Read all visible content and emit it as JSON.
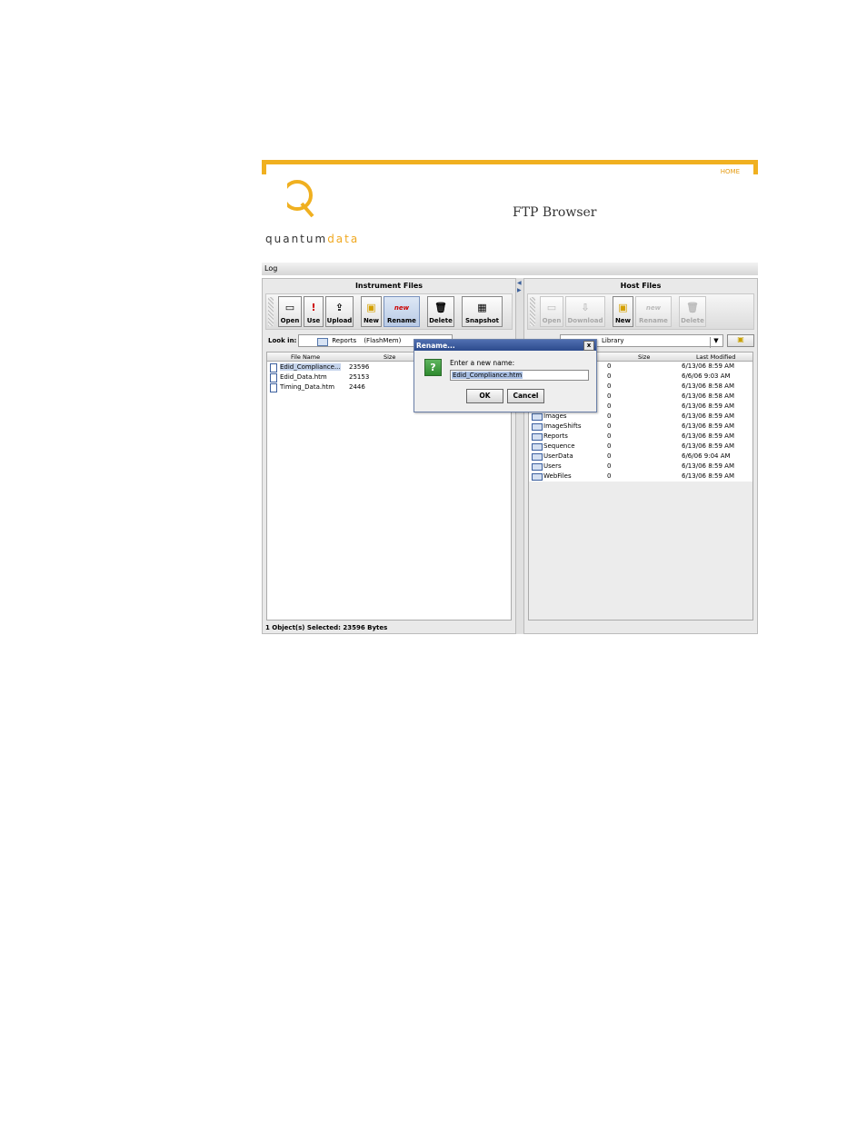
{
  "header": {
    "home": "HOME",
    "logo_main": "quantum",
    "logo_accent": "data",
    "title": "FTP Browser"
  },
  "log": {
    "label": "Log"
  },
  "instrument": {
    "title": "Instrument Files",
    "toolbar": {
      "open": "Open",
      "use": "Use",
      "upload": "Upload",
      "new": "New",
      "rename": "Rename",
      "delete": "Delete",
      "snapshot": "Snapshot"
    },
    "look_in_label": "Look in:",
    "look_in_value": "Reports",
    "look_in_extra": "(FlashMem)",
    "columns": {
      "name": "File Name",
      "size": "Size"
    },
    "files": [
      {
        "name": "Edid_Compliance...",
        "size": "23596"
      },
      {
        "name": "Edid_Data.htm",
        "size": "25153"
      },
      {
        "name": "Timing_Data.htm",
        "size": "2446"
      }
    ],
    "status": "1 Object(s) Selected:  23596 Bytes"
  },
  "host": {
    "title": "Host Files",
    "toolbar": {
      "open": "Open",
      "download": "Download",
      "new": "New",
      "rename": "Rename",
      "delete": "Delete"
    },
    "look_in_value": "Library",
    "columns": {
      "size": "Size",
      "modified": "Last Modified"
    },
    "rows": [
      {
        "name": "",
        "size": "0",
        "modified": "6/13/06 8:59 AM"
      },
      {
        "name": "",
        "size": "0",
        "modified": "6/6/06 9:03 AM"
      },
      {
        "name": "",
        "size": "0",
        "modified": "6/13/06 8:58 AM"
      },
      {
        "name": "",
        "size": "0",
        "modified": "6/13/06 8:58 AM"
      },
      {
        "name": "",
        "size": "0",
        "modified": "6/13/06 8:59 AM"
      },
      {
        "name": "Images",
        "size": "0",
        "modified": "6/13/06 8:59 AM"
      },
      {
        "name": "ImageShifts",
        "size": "0",
        "modified": "6/13/06 8:59 AM"
      },
      {
        "name": "Reports",
        "size": "0",
        "modified": "6/13/06 8:59 AM"
      },
      {
        "name": "Sequence",
        "size": "0",
        "modified": "6/13/06 8:59 AM"
      },
      {
        "name": "UserData",
        "size": "0",
        "modified": "6/6/06 9:04 AM"
      },
      {
        "name": "Users",
        "size": "0",
        "modified": "6/13/06 8:59 AM"
      },
      {
        "name": "WebFiles",
        "size": "0",
        "modified": "6/13/06 8:59 AM"
      }
    ]
  },
  "dialog": {
    "title": "Rename...",
    "prompt": "Enter a new name:",
    "value": "Edid_Compliance.htm",
    "ok": "OK",
    "cancel": "Cancel",
    "close": "x"
  },
  "colors": {
    "accent": "#f0b020",
    "title_bar": "#2c4a8c",
    "selection": "#c5d4ec"
  }
}
